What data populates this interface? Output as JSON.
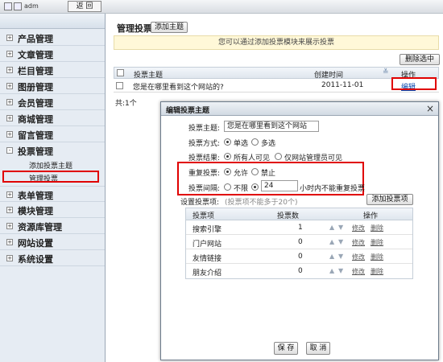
{
  "topbar": {
    "user": "adm",
    "back_label": "返 回"
  },
  "sidebar": {
    "items": [
      {
        "label": "产品管理",
        "sign": "+"
      },
      {
        "label": "文章管理",
        "sign": "+"
      },
      {
        "label": "栏目管理",
        "sign": "+"
      },
      {
        "label": "图册管理",
        "sign": "+"
      },
      {
        "label": "会员管理",
        "sign": "+"
      },
      {
        "label": "商城管理",
        "sign": "+"
      },
      {
        "label": "留言管理",
        "sign": "+"
      },
      {
        "label": "投票管理",
        "sign": "-"
      },
      {
        "label": "表单管理",
        "sign": "+"
      },
      {
        "label": "模块管理",
        "sign": "+"
      },
      {
        "label": "资源库管理",
        "sign": "+"
      },
      {
        "label": "网站设置",
        "sign": "+"
      },
      {
        "label": "系统设置",
        "sign": "+"
      }
    ],
    "subitems": [
      "添加投票主题",
      "管理投票"
    ]
  },
  "main": {
    "title": "管理投票",
    "add_button": "添加主题",
    "tip": "您可以通过添加投票模块来展示投票",
    "delete_button": "删除选中",
    "table": {
      "headers": {
        "topic": "投票主题",
        "created": "创建时间",
        "ops": "操作",
        "sort_icon": "≚"
      },
      "rows": [
        {
          "topic": "您是在哪里看到这个网站的?",
          "created": "2011-11-01",
          "op": "编辑"
        }
      ]
    },
    "total": "共:1个"
  },
  "modal": {
    "title": "编辑投票主题",
    "close": "×",
    "fields": {
      "topic_label": "投票主题:",
      "topic_value": "您是在哪里看到这个网站",
      "mode_label": "投票方式:",
      "mode_options": [
        "单选",
        "多选"
      ],
      "result_label": "投票结果:",
      "result_options": [
        "所有人可见",
        "仅网站管理员可见"
      ],
      "repeat_label": "重复投票:",
      "repeat_options": [
        "允许",
        "禁止"
      ],
      "interval_label": "投票间隔:",
      "interval_options": [
        "不限"
      ],
      "interval_value": "24",
      "interval_suffix": "小时内不能重复投票",
      "items_label": "设置投票项:",
      "items_hint": "(投票项不能多于20个)",
      "add_item_button": "添加投票项"
    },
    "items_table": {
      "headers": {
        "item": "投票项",
        "count": "投票数",
        "ops": "操作"
      },
      "rows": [
        {
          "item": "搜索引擎",
          "count": "1",
          "edit": "修改",
          "del": "删除"
        },
        {
          "item": "门户网站",
          "count": "0",
          "edit": "修改",
          "del": "删除"
        },
        {
          "item": "友情链接",
          "count": "0",
          "edit": "修改",
          "del": "删除"
        },
        {
          "item": "朋友介绍",
          "count": "0",
          "edit": "修改",
          "del": "删除"
        }
      ]
    },
    "save": "保 存",
    "cancel": "取 消"
  }
}
